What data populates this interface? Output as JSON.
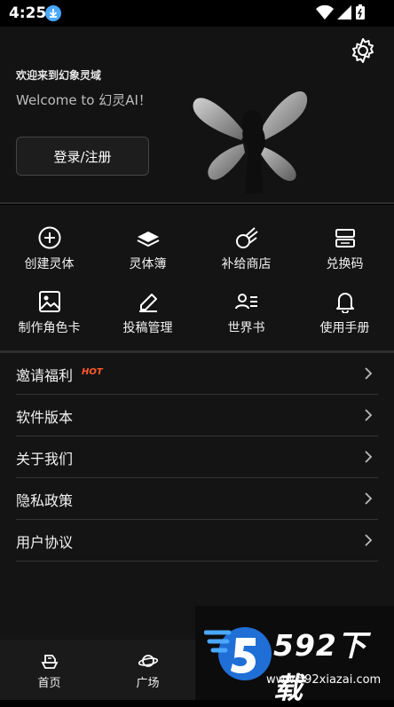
{
  "status_bar": {
    "time": "4:25"
  },
  "hero": {
    "welcome_cn": "欢迎来到幻象灵域",
    "welcome_en": "Welcome to 幻灵AI！",
    "login_label": "登录/注册"
  },
  "grid": {
    "items": [
      {
        "label": "创建灵体",
        "icon": "plus-circle-icon"
      },
      {
        "label": "灵体簿",
        "icon": "book-icon"
      },
      {
        "label": "补给商店",
        "icon": "comet-icon"
      },
      {
        "label": "兑换码",
        "icon": "redeem-code-icon"
      },
      {
        "label": "制作角色卡",
        "icon": "image-icon"
      },
      {
        "label": "投稿管理",
        "icon": "edit-icon"
      },
      {
        "label": "世界书",
        "icon": "user-list-icon"
      },
      {
        "label": "使用手册",
        "icon": "bell-icon"
      }
    ]
  },
  "menu": {
    "items": [
      {
        "label": "邀请福利",
        "badge": "HOT"
      },
      {
        "label": "软件版本"
      },
      {
        "label": "关于我们"
      },
      {
        "label": "隐私政策"
      },
      {
        "label": "用户协议"
      }
    ]
  },
  "tabbar": {
    "tabs": [
      {
        "label": "首页",
        "icon": "home-ship-icon"
      },
      {
        "label": "广场",
        "icon": "planet-icon"
      }
    ]
  },
  "watermark": {
    "brand": "592下载",
    "url": "www.592xiazai.com"
  },
  "colors": {
    "background": "#141414",
    "hot_badge": "#ff5a2a",
    "download_badge": "#4aa8ff"
  }
}
